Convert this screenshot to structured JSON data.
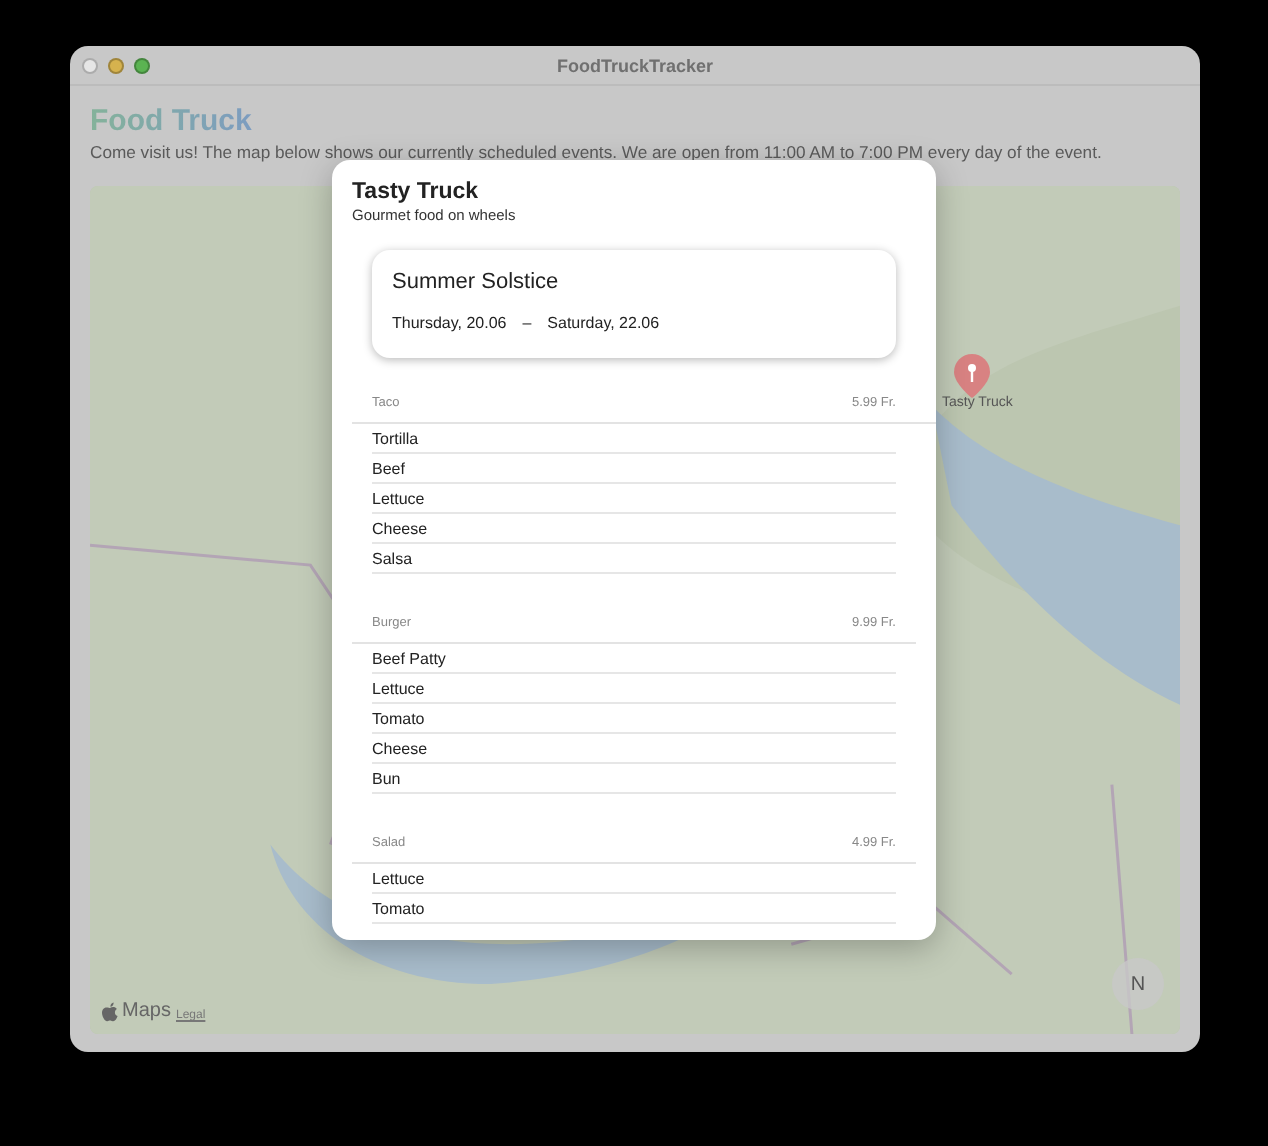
{
  "window": {
    "title": "FoodTruckTracker"
  },
  "header": {
    "title": "Food Truck",
    "subtitle": "Come visit us! The map below shows our currently scheduled events. We are open from 11:00 AM to 7:00 PM every day of the event."
  },
  "map": {
    "pin_label": "Tasty Truck",
    "logo": "Maps",
    "legal": "Legal",
    "compass": "N"
  },
  "sheet": {
    "title": "Tasty Truck",
    "subtitle": "Gourmet food on wheels",
    "event": {
      "name": "Summer Solstice",
      "start": "Thursday, 20.06",
      "separator": "–",
      "end": "Saturday, 22.06"
    },
    "menu": [
      {
        "name": "Taco",
        "price": "5.99 Fr.",
        "ingredients": [
          "Tortilla",
          "Beef",
          "Lettuce",
          "Cheese",
          "Salsa"
        ]
      },
      {
        "name": "Burger",
        "price": "9.99 Fr.",
        "ingredients": [
          "Beef Patty",
          "Lettuce",
          "Tomato",
          "Cheese",
          "Bun"
        ]
      },
      {
        "name": "Salad",
        "price": "4.99 Fr.",
        "ingredients": [
          "Lettuce",
          "Tomato"
        ]
      }
    ]
  }
}
